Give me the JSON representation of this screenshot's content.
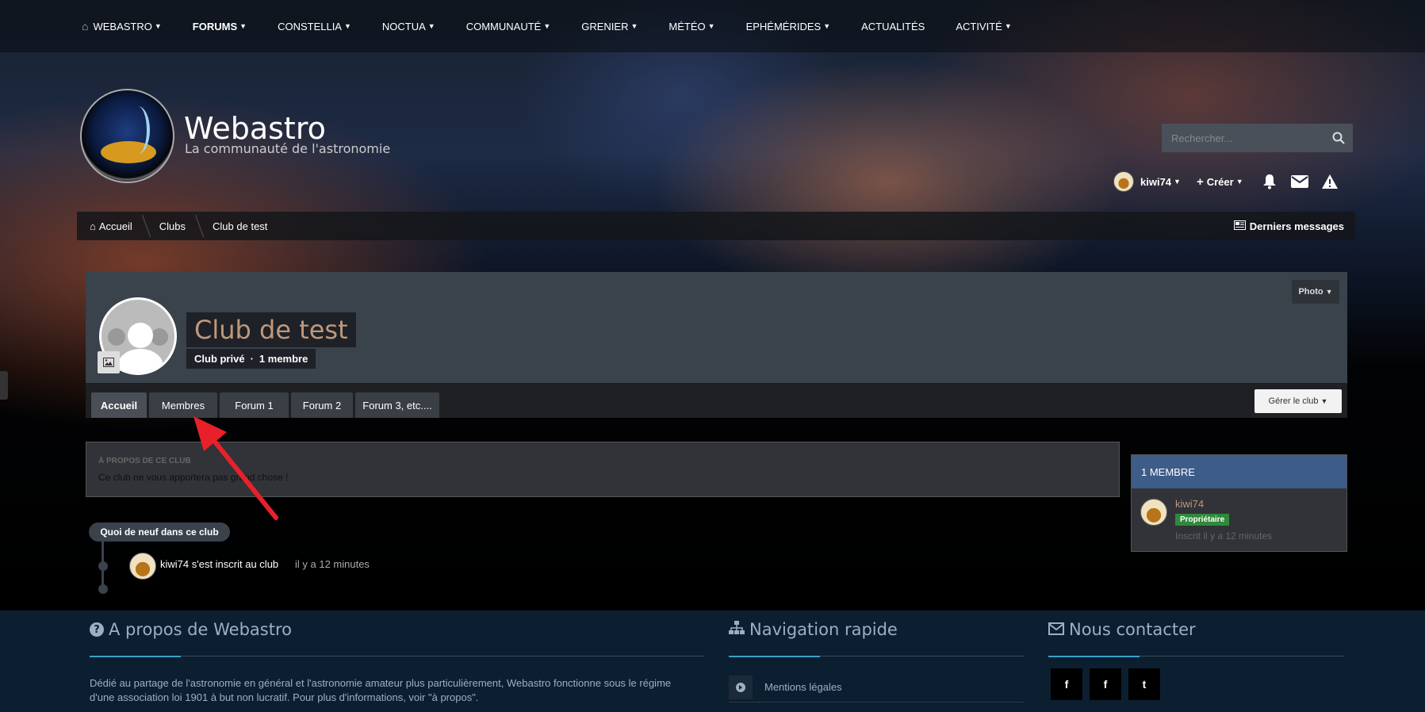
{
  "topnav": {
    "items": [
      {
        "label": "WEBASTRO",
        "active": false
      },
      {
        "label": "FORUMS",
        "active": true
      },
      {
        "label": "CONSTELLIA",
        "active": false
      },
      {
        "label": "NOCTUA",
        "active": false
      },
      {
        "label": "COMMUNAUTÉ",
        "active": false
      },
      {
        "label": "GRENIER",
        "active": false
      },
      {
        "label": "MÉTÉO",
        "active": false
      },
      {
        "label": "EPHÉMÉRIDES",
        "active": false
      },
      {
        "label": "ACTUALITÉS",
        "active": false
      },
      {
        "label": "ACTIVITÉ",
        "active": false
      }
    ],
    "home_icon": "house-icon"
  },
  "site": {
    "title": "Webastro",
    "subtitle": "La communauté de l'astronomie"
  },
  "search": {
    "placeholder": "Rechercher..."
  },
  "userbar": {
    "username": "kiwi74",
    "create_label": "Créer"
  },
  "breadcrumb": {
    "items": [
      "Accueil",
      "Clubs",
      "Club de test"
    ],
    "right_link": "Derniers messages"
  },
  "club": {
    "photo_button": "Photo",
    "title": "Club de test",
    "type": "Club privé",
    "separator": "·",
    "members_count": "1 membre",
    "tabs": [
      "Accueil",
      "Membres",
      "Forum 1",
      "Forum 2",
      "Forum 3, etc...."
    ],
    "manage_button": "Gérer le club"
  },
  "about_club": {
    "heading": "À PROPOS DE CE CLUB",
    "text": "Ce club ne vous apportera pas grand chose !"
  },
  "members_panel": {
    "heading": "1 MEMBRE",
    "member": {
      "name": "kiwi74",
      "role": "Propriétaire",
      "joined": "Inscrit il y a 12 minutes"
    }
  },
  "activity": {
    "pill": "Quoi de neuf dans ce club",
    "entry_text": "kiwi74 s'est inscrit au club",
    "entry_time": "il y a 12 minutes"
  },
  "footer": {
    "about_heading": "A propos de Webastro",
    "about_text": "Dédié au partage de l'astronomie en général et l'astronomie amateur plus particulièrement, Webastro fonctionne sous le régime d'une association loi 1901 à but non lucratif. Pour plus d'informations, voir \"à propos\".",
    "nav_heading": "Navigation rapide",
    "nav_item": "Mentions légales",
    "contact_heading": "Nous contacter",
    "social": [
      "f",
      "f",
      "t"
    ]
  },
  "colors": {
    "accent": "#3d5c88",
    "club_title": "#c0987a",
    "owner_badge": "#2f8a3a",
    "footer_bg": "#0c1f30",
    "annotation_arrow": "#e8202a"
  }
}
